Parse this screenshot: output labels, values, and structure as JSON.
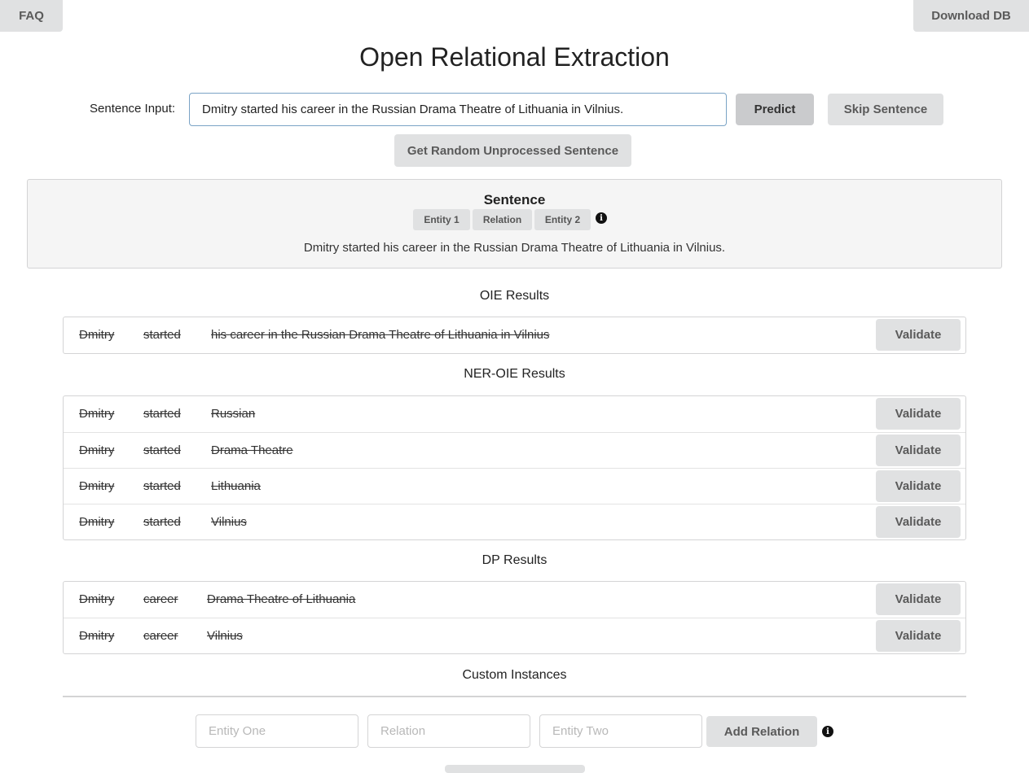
{
  "header": {
    "faq_label": "FAQ",
    "download_label": "Download DB",
    "title": "Open Relational Extraction"
  },
  "input": {
    "label": "Sentence Input:",
    "value": "Dmitry started his career in the Russian Drama Theatre of Lithuania in Vilnius.",
    "predict_label": "Predict",
    "skip_label": "Skip Sentence",
    "random_label": "Get Random Unprocessed Sentence"
  },
  "sentence": {
    "heading": "Sentence",
    "legend": [
      "Entity 1",
      "Relation",
      "Entity 2"
    ],
    "text": "Dmitry started his career in the Russian Drama Theatre of Lithuania in Vilnius."
  },
  "oie": {
    "title": "OIE Results",
    "rows": [
      [
        "Dmitry",
        "started",
        "his career in the Russian Drama Theatre of Lithuania in Vilnius"
      ]
    ]
  },
  "ner_oie": {
    "title": "NER-OIE Results",
    "rows": [
      [
        "Dmitry",
        "started",
        "Russian"
      ],
      [
        "Dmitry",
        "started",
        "Drama Theatre"
      ],
      [
        "Dmitry",
        "started",
        "Lithuania"
      ],
      [
        "Dmitry",
        "started",
        "Vilnius"
      ]
    ]
  },
  "dp": {
    "title": "DP Results",
    "rows": [
      [
        "Dmitry",
        "career",
        "Drama Theatre of Lithuania"
      ],
      [
        "Dmitry",
        "career",
        "Vilnius"
      ]
    ]
  },
  "validate_label": "Validate",
  "custom": {
    "title": "Custom Instances",
    "entity_one_placeholder": "Entity One",
    "relation_placeholder": "Relation",
    "entity_two_placeholder": "Entity Two",
    "add_label": "Add Relation"
  },
  "icons": {
    "info": "info-icon"
  }
}
